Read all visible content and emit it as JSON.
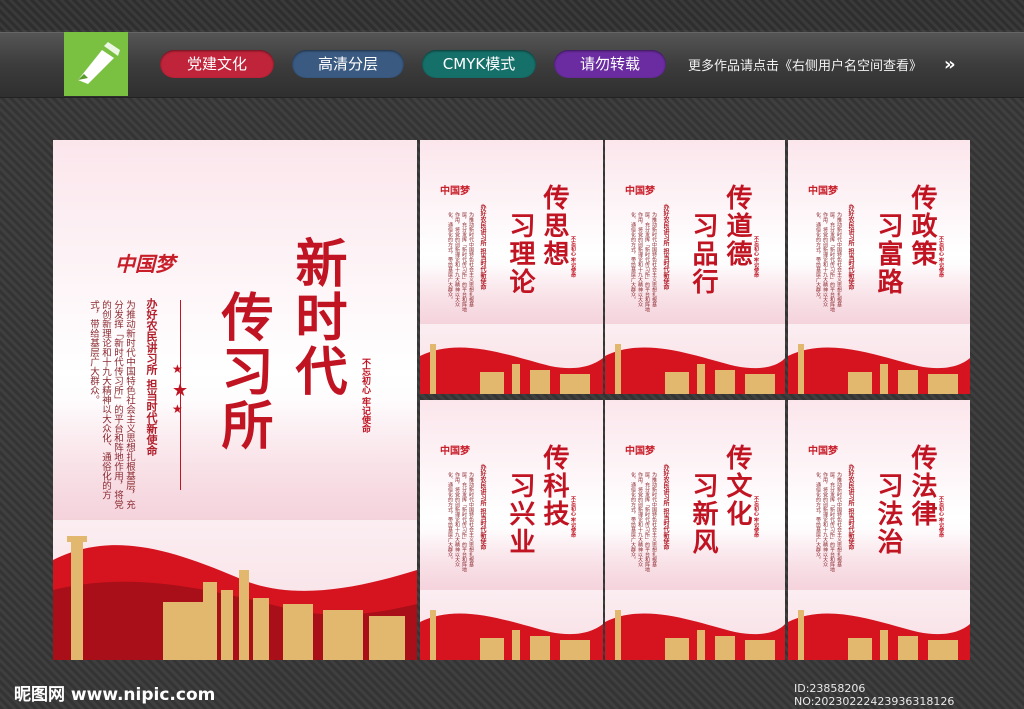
{
  "header": {
    "tags": [
      "党建文化",
      "高清分层",
      "CMYK模式",
      "请勿转载"
    ],
    "more_text": "更多作品请点击《右侧用户名空间查看》",
    "arrow": "»",
    "logo_icon": "pen-nib-icon"
  },
  "main_poster": {
    "emblem": "中国梦",
    "title_line1": "新时代",
    "title_line2": "传习所",
    "slogan": "办好农民讲习所 担当时代新使命",
    "body": "为推动新时代中国特色社会主义思想扎根基层，充分发挥「新时代传习所」的平台和阵地作用，将党的创新理论和十九大精神以大众化、通俗化的方式，带给基层广大群众。",
    "seal_text": "不忘初心 牢记使命"
  },
  "small_posters": [
    {
      "title_line1": "传思想",
      "title_line2": "习理论"
    },
    {
      "title_line1": "传道德",
      "title_line2": "习品行"
    },
    {
      "title_line1": "传政策",
      "title_line2": "习富路"
    },
    {
      "title_line1": "传科技",
      "title_line2": "习兴业"
    },
    {
      "title_line1": "传文化",
      "title_line2": "习新风"
    },
    {
      "title_line1": "传法律",
      "title_line2": "习法治"
    }
  ],
  "small_common": {
    "emblem": "中国梦",
    "slogan": "办好农民讲习所 担当时代新使命",
    "body": "为推动新时代中国特色社会主义思想扎根基层，充分发挥「新时代传习所」的平台和阵地作用，将党的创新理论和十九大精神以大众化、通俗化的方式，带给基层广大群众。",
    "seal_text": "不忘初心 牢记使命"
  },
  "footer": {
    "site": "昵图网 www.nipic.com",
    "id_text": "ID:23858206 NO:20230222423936318126"
  },
  "colors": {
    "accent_red": "#c01423",
    "logo_green": "#7ac142"
  }
}
